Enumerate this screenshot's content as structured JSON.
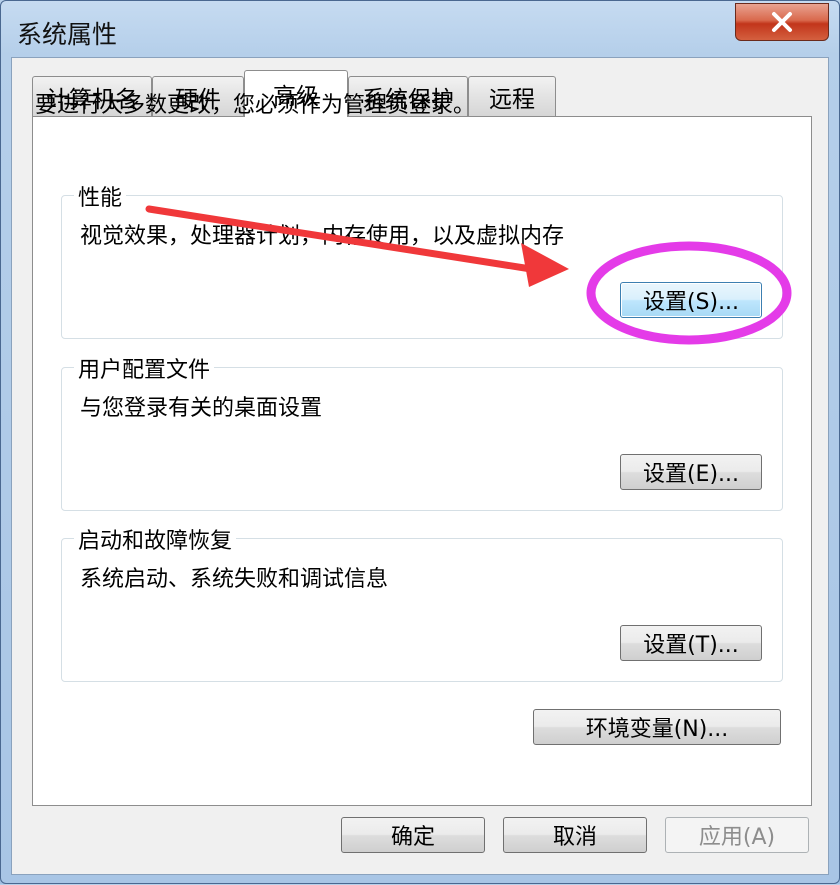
{
  "window": {
    "title": "系统属性",
    "close_glyph": "✕"
  },
  "tabs": [
    {
      "label": "计算机名"
    },
    {
      "label": "硬件"
    },
    {
      "label": "高级",
      "active": true
    },
    {
      "label": "系统保护"
    },
    {
      "label": "远程"
    }
  ],
  "advanced": {
    "intro": "要进行大多数更改，您必须作为管理员登录。",
    "performance": {
      "title": "性能",
      "description": "视觉效果，处理器计划，内存使用，以及虚拟内存",
      "button": "设置(S)..."
    },
    "user_profiles": {
      "title": "用户配置文件",
      "description": "与您登录有关的桌面设置",
      "button": "设置(E)..."
    },
    "startup_recovery": {
      "title": "启动和故障恢复",
      "description": "系统启动、系统失败和调试信息",
      "button": "设置(T)..."
    },
    "env_button": "环境变量(N)..."
  },
  "footer": {
    "ok": "确定",
    "cancel": "取消",
    "apply": "应用(A)"
  },
  "colors": {
    "annotation_arrow": "#f0383a",
    "annotation_circle": "#e43be8",
    "close_button": "#c2351b"
  }
}
